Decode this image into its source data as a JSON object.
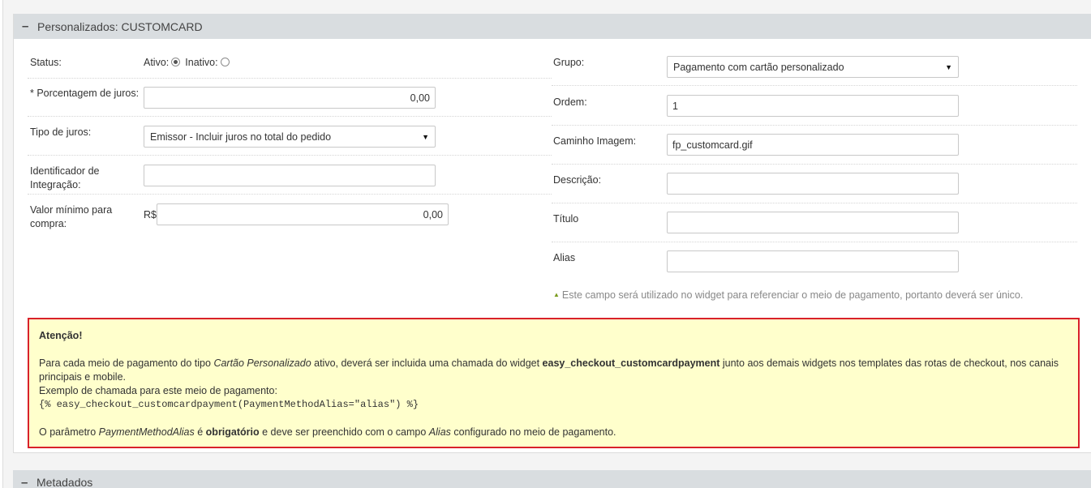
{
  "section": {
    "collapse_symbol": "–",
    "title": "Personalizados: CUSTOMCARD"
  },
  "left": {
    "status_label": "Status:",
    "ativo_label": "Ativo:",
    "inativo_label": "Inativo:",
    "juros_label": "* Porcentagem de juros:",
    "juros_value": "0,00",
    "tipo_label": "Tipo de juros:",
    "tipo_value": "Emissor - Incluir juros no total do pedido",
    "ident_label_1": "Identificador de",
    "ident_label_2": "Integração:",
    "ident_value": "",
    "valor_label_1": "Valor mínimo para",
    "valor_label_2": "compra:",
    "currency": "R$",
    "valor_value": "0,00"
  },
  "right": {
    "grupo_label": "Grupo:",
    "grupo_value": "Pagamento com cartão personalizado",
    "ordem_label": "Ordem:",
    "ordem_value": "1",
    "caminho_label": "Caminho Imagem:",
    "caminho_value": "fp_customcard.gif",
    "descricao_label": "Descrição:",
    "descricao_value": "",
    "titulo_label": "Título",
    "titulo_value": "",
    "alias_label": "Alias",
    "alias_value": "",
    "hint": "Este campo será utilizado no widget para referenciar o meio de pagamento, portanto deverá ser único."
  },
  "alert": {
    "heading": "Atenção!",
    "p1_a": "Para cada meio de pagamento do tipo ",
    "p1_em": "Cartão Personalizado",
    "p1_b": " ativo, deverá ser incluida uma chamada do widget ",
    "p1_strong": "easy_checkout_customcardpayment",
    "p1_c": " junto aos demais widgets nos templates das rotas de checkout, nos canais principais e mobile.",
    "p2": "Exemplo de chamada para este meio de pagamento:",
    "code": "{% easy_checkout_customcardpayment(PaymentMethodAlias=\"alias\") %}",
    "p3_a": "O parâmetro ",
    "p3_em1": "PaymentMethodAlias",
    "p3_b": " é ",
    "p3_strong": "obrigatório",
    "p3_c": " e deve ser preenchido com o campo ",
    "p3_em2": "Alias",
    "p3_d": " configurado no meio de pagamento."
  },
  "metadados": {
    "collapse_symbol": "–",
    "title": "Metadados"
  },
  "colors": {
    "header_bg": "#d9dde0",
    "alert_bg": "#ffffcc",
    "alert_border": "#d9212a",
    "hint_arrow": "#7a9b1e"
  }
}
